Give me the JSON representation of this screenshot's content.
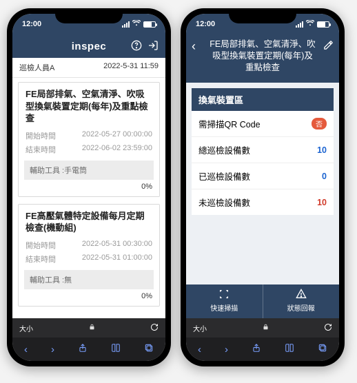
{
  "status": {
    "time": "12:00"
  },
  "colors": {
    "primary": "#2f4664",
    "blue": "#1b63d0",
    "red": "#d03a2a",
    "pill": "#e55a3c"
  },
  "left": {
    "brand": "inspec",
    "icons": {
      "help": "help-circle-icon",
      "login": "login-icon"
    },
    "user": "巡檢人員A",
    "timestamp": "2022-5-31 11:59",
    "cards": [
      {
        "title": "FE局部排氣、空氣清淨、吹吸型換氣裝置定期(每年)及重點檢查",
        "start_label": "開始時間",
        "start_value": "2022-05-27 00:00:00",
        "end_label": "結束時間",
        "end_value": "2022-06-02 23:59:00",
        "tool_label": "輔助工具 :",
        "tool_value": "手電筒",
        "progress": "0%"
      },
      {
        "title": "FE高壓氣體特定設備每月定期檢查(機動組)",
        "start_label": "開始時間",
        "start_value": "2022-05-31 00:30:00",
        "end_label": "結束時間",
        "end_value": "2022-05-31 01:00:00",
        "tool_label": "輔助工具 :",
        "tool_value": "無",
        "progress": "0%"
      }
    ]
  },
  "right": {
    "page_title": "FE局部排氣、空氣清淨、吹吸型換氣裝置定期(每年)及重點檢查",
    "section_title": "換氣裝置區",
    "rows": [
      {
        "label": "需掃描QR Code",
        "kind": "pill",
        "value": "否"
      },
      {
        "label": "總巡檢設備數",
        "kind": "blue",
        "value": "10"
      },
      {
        "label": "已巡檢設備數",
        "kind": "blue",
        "value": "0"
      },
      {
        "label": "未巡檢設備數",
        "kind": "red",
        "value": "10"
      }
    ],
    "buttons": {
      "scan": "快速掃描",
      "report": "狀態回報"
    }
  },
  "browser": {
    "aa": "大小",
    "toolbar_icons": {
      "back": "chevron-left-icon",
      "forward": "chevron-right-icon",
      "share": "share-icon",
      "book": "book-icon",
      "tabs": "tabs-icon"
    }
  }
}
